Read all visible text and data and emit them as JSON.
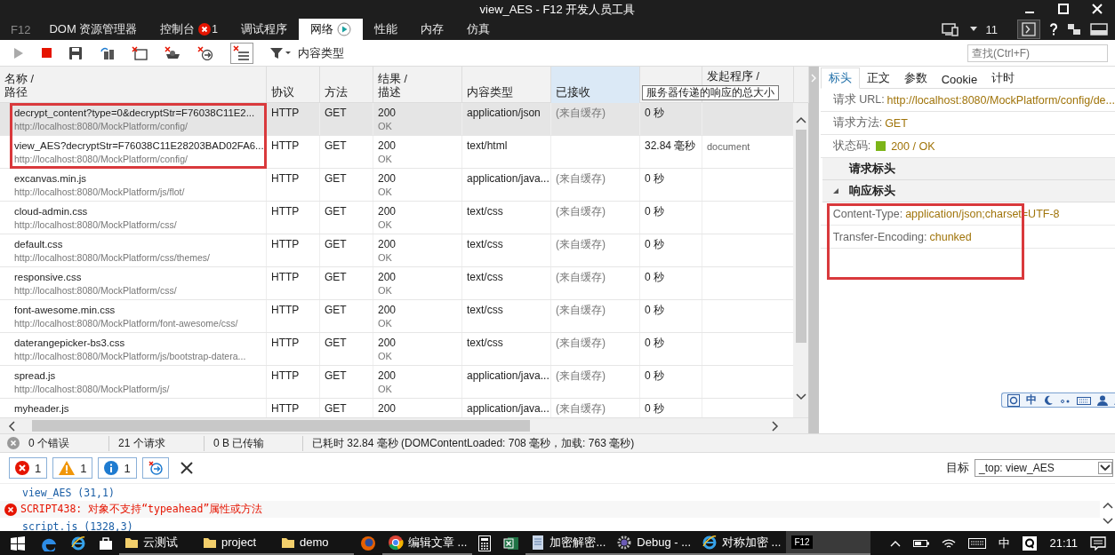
{
  "window": {
    "title": "view_AES - F12 开发人员工具"
  },
  "tabs": [
    {
      "label": "F12",
      "kind": "brand",
      "selected": false
    },
    {
      "label": "DOM 资源管理器",
      "kind": "plain",
      "selected": false
    },
    {
      "label": "控制台",
      "kind": "errors",
      "badge": "1",
      "selected": false
    },
    {
      "label": "调试程序",
      "kind": "plain",
      "selected": false
    },
    {
      "label": "网络",
      "kind": "recording",
      "selected": true
    },
    {
      "label": "性能",
      "kind": "plain",
      "selected": false
    },
    {
      "label": "内存",
      "kind": "plain",
      "selected": false
    },
    {
      "label": "仿真",
      "kind": "plain",
      "selected": false
    }
  ],
  "document_mode": "11",
  "toolbar": {
    "filter_label": "内容类型",
    "search_placeholder": "查找(Ctrl+F)"
  },
  "columns": [
    {
      "label": "名称 /\n路径",
      "highlighted": false
    },
    {
      "label": "协议",
      "highlighted": false
    },
    {
      "label": "方法",
      "highlighted": false
    },
    {
      "label": "结果 /\n描述",
      "highlighted": false
    },
    {
      "label": "内容类型",
      "highlighted": false
    },
    {
      "label": "已接收",
      "highlighted": true
    },
    {
      "label": "发起程序 /",
      "highlighted": false
    }
  ],
  "tooltip": "服务器传递的响应的总大小",
  "requests": [
    {
      "name": "decrypt_content?type=0&decryptStr=F76038C11E2...",
      "path": "http://localhost:8080/MockPlatform/config/",
      "protocol": "HTTP",
      "method": "GET",
      "status": "200",
      "status_text": "OK",
      "type": "application/json",
      "received": "(来自缓存)",
      "time": "0 秒",
      "selected": true,
      "marked": true
    },
    {
      "name": "view_AES?decryptStr=F76038C11E28203BAD02FA6...",
      "path": "http://localhost:8080/MockPlatform/config/",
      "protocol": "HTTP",
      "method": "GET",
      "status": "200",
      "status_text": "OK",
      "type": "text/html",
      "time": "32.84 毫秒",
      "initiator": "document",
      "selected": false,
      "marked": true
    },
    {
      "name": "excanvas.min.js",
      "path": "http://localhost:8080/MockPlatform/js/flot/",
      "protocol": "HTTP",
      "method": "GET",
      "status": "200",
      "status_text": "OK",
      "type": "application/java...",
      "received": "(来自缓存)",
      "time": "0 秒",
      "selected": false,
      "marked": false
    },
    {
      "name": "cloud-admin.css",
      "path": "http://localhost:8080/MockPlatform/css/",
      "protocol": "HTTP",
      "method": "GET",
      "status": "200",
      "status_text": "OK",
      "type": "text/css",
      "received": "(来自缓存)",
      "time": "0 秒",
      "selected": false,
      "marked": false
    },
    {
      "name": "default.css",
      "path": "http://localhost:8080/MockPlatform/css/themes/",
      "protocol": "HTTP",
      "method": "GET",
      "status": "200",
      "status_text": "OK",
      "type": "text/css",
      "received": "(来自缓存)",
      "time": "0 秒",
      "selected": false,
      "marked": false
    },
    {
      "name": "responsive.css",
      "path": "http://localhost:8080/MockPlatform/css/",
      "protocol": "HTTP",
      "method": "GET",
      "status": "200",
      "status_text": "OK",
      "type": "text/css",
      "received": "(来自缓存)",
      "time": "0 秒",
      "selected": false,
      "marked": false
    },
    {
      "name": "font-awesome.min.css",
      "path": "http://localhost:8080/MockPlatform/font-awesome/css/",
      "protocol": "HTTP",
      "method": "GET",
      "status": "200",
      "status_text": "OK",
      "type": "text/css",
      "received": "(来自缓存)",
      "time": "0 秒",
      "selected": false,
      "marked": false
    },
    {
      "name": "daterangepicker-bs3.css",
      "path": "http://localhost:8080/MockPlatform/js/bootstrap-datera...",
      "protocol": "HTTP",
      "method": "GET",
      "status": "200",
      "status_text": "OK",
      "type": "text/css",
      "received": "(来自缓存)",
      "time": "0 秒",
      "selected": false,
      "marked": false
    },
    {
      "name": "spread.js",
      "path": "http://localhost:8080/MockPlatform/js/",
      "protocol": "HTTP",
      "method": "GET",
      "status": "200",
      "status_text": "OK",
      "type": "application/java...",
      "received": "(来自缓存)",
      "time": "0 秒",
      "selected": false,
      "marked": false
    },
    {
      "name": "myheader.js",
      "protocol": "HTTP",
      "method": "GET",
      "status": "200",
      "type": "application/java...",
      "received": "(来自缓存)",
      "time": "0 秒",
      "selected": false,
      "marked": false
    }
  ],
  "details": {
    "tabs": [
      {
        "label": "标头",
        "selected": true
      },
      {
        "label": "正文",
        "selected": false
      },
      {
        "label": "参数",
        "selected": false
      },
      {
        "label": "Cookie",
        "selected": false
      },
      {
        "label": "计时",
        "selected": false
      }
    ],
    "fields": [
      {
        "label": "请求 URL:",
        "value": "http://localhost:8080/MockPlatform/config/de..."
      },
      {
        "label": "请求方法:",
        "value": "GET"
      },
      {
        "label": "状态码:",
        "value": "200 / OK",
        "color": "#7cb518"
      }
    ],
    "sections": [
      {
        "label": "请求标头",
        "expanded": false
      },
      {
        "label": "响应标头",
        "expanded": true,
        "marked": true,
        "headers": [
          {
            "name": "Content-Type:",
            "value": "application/json;charset=UTF-8"
          },
          {
            "name": "Transfer-Encoding:",
            "value": "chunked"
          }
        ]
      }
    ]
  },
  "ime_toolbar": {
    "mode": "中"
  },
  "status_bar": {
    "errors": "0 个错误",
    "requests": "21 个请求",
    "transferred": "0 B 已传输",
    "timing": "已耗时 32.84 毫秒 (DOMContentLoaded: 708 毫秒，加载: 763 毫秒)"
  },
  "console": {
    "filters": [
      {
        "kind": "error",
        "count": "1"
      },
      {
        "kind": "warning",
        "count": "1"
      },
      {
        "kind": "info",
        "count": "1"
      }
    ],
    "target_label": "目标",
    "target_value": "_top: view_AES",
    "messages": [
      {
        "kind": "location",
        "text": "view_AES (31,1)"
      },
      {
        "kind": "error",
        "text": "SCRIPT438: 对象不支持“typeahead”属性或方法"
      },
      {
        "kind": "location",
        "text": "script.js (1328,3)"
      }
    ]
  },
  "taskbar": {
    "items": [
      {
        "kind": "edge",
        "active": false
      },
      {
        "kind": "ie",
        "active": false
      },
      {
        "kind": "store",
        "active": false
      },
      {
        "kind": "folder",
        "label": "云测试",
        "active": false
      },
      {
        "kind": "folder",
        "label": "project",
        "active": false
      },
      {
        "kind": "folder",
        "label": "demo",
        "active": false
      },
      {
        "kind": "firefox",
        "active": false
      },
      {
        "kind": "chrome",
        "label": "编辑文章 ...",
        "active": false
      },
      {
        "kind": "calculator",
        "active": false
      },
      {
        "kind": "excel",
        "active": false
      },
      {
        "kind": "document",
        "label": "加密解密...",
        "active": false
      },
      {
        "kind": "gear",
        "label": "Debug - ...",
        "active": false
      },
      {
        "kind": "ie",
        "label": "对称加密 ...",
        "active": false
      },
      {
        "kind": "devtools",
        "label": "F12",
        "active": true
      }
    ],
    "ime": "中",
    "time": "21:11"
  }
}
